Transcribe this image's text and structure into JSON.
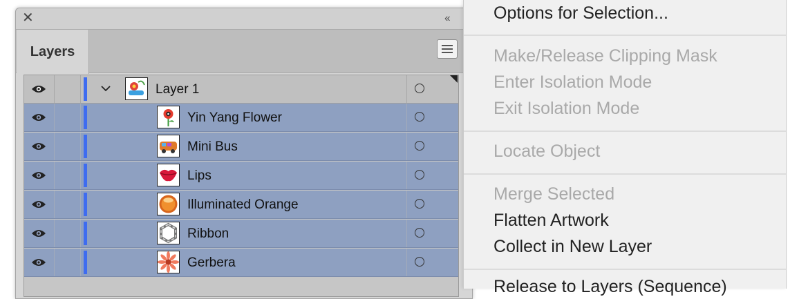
{
  "panel": {
    "close_glyph": "✕",
    "collapse_glyph": "‹‹",
    "tab_label": "Layers",
    "menu_icon": "hamburger-menu-icon"
  },
  "layers": {
    "parent": {
      "name": "Layer 1",
      "expanded": true,
      "color": "#3e6cf0"
    },
    "items": [
      {
        "name": "Yin Yang Flower"
      },
      {
        "name": "Mini Bus"
      },
      {
        "name": "Lips"
      },
      {
        "name": "Illuminated Orange"
      },
      {
        "name": "Ribbon"
      },
      {
        "name": "Gerbera"
      }
    ],
    "selection_color": "#8ea0c1"
  },
  "context_menu": {
    "options_for_selection": "Options for Selection...",
    "make_release_clipping_mask": "Make/Release Clipping Mask",
    "enter_isolation_mode": "Enter Isolation Mode",
    "exit_isolation_mode": "Exit Isolation Mode",
    "locate_object": "Locate Object",
    "merge_selected": "Merge Selected",
    "flatten_artwork": "Flatten Artwork",
    "collect_in_new_layer": "Collect in New Layer",
    "release_to_layers": "Release to Layers (Sequence)"
  }
}
